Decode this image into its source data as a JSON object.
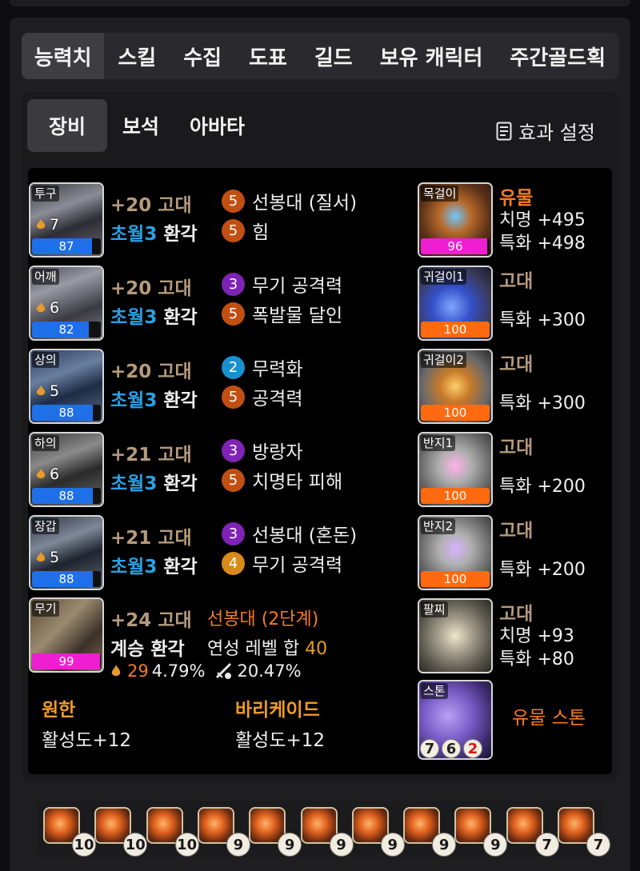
{
  "main_tabs": [
    "능력치",
    "스킬",
    "수집",
    "도표",
    "길드",
    "보유 캐릭터",
    "주간골드획"
  ],
  "sub_tabs": [
    "장비",
    "보석",
    "아바타"
  ],
  "effect_button": "효과 설정",
  "equipment": [
    {
      "slot": "투구",
      "level": "7",
      "quality": 87,
      "quality_color": "#1f6fe8",
      "upgrade": "+20 고대",
      "transcend": "초월3",
      "elixir": "환각",
      "engravings": [
        {
          "level": "5",
          "color": "orange",
          "name": "선봉대 (질서)"
        },
        {
          "level": "5",
          "color": "orange",
          "name": "힘"
        }
      ]
    },
    {
      "slot": "어깨",
      "level": "6",
      "quality": 82,
      "quality_color": "#1f6fe8",
      "upgrade": "+20 고대",
      "transcend": "초월3",
      "elixir": "환각",
      "engravings": [
        {
          "level": "3",
          "color": "purple",
          "name": "무기 공격력"
        },
        {
          "level": "5",
          "color": "orange",
          "name": "폭발물 달인"
        }
      ]
    },
    {
      "slot": "상의",
      "level": "5",
      "quality": 88,
      "quality_color": "#1f6fe8",
      "upgrade": "+20 고대",
      "transcend": "초월3",
      "elixir": "환각",
      "engravings": [
        {
          "level": "2",
          "color": "blue",
          "name": "무력화"
        },
        {
          "level": "5",
          "color": "orange",
          "name": "공격력"
        }
      ]
    },
    {
      "slot": "하의",
      "level": "6",
      "quality": 88,
      "quality_color": "#1f6fe8",
      "upgrade": "+21 고대",
      "transcend": "초월3",
      "elixir": "환각",
      "engravings": [
        {
          "level": "3",
          "color": "purple",
          "name": "방랑자"
        },
        {
          "level": "5",
          "color": "orange",
          "name": "치명타 피해"
        }
      ]
    },
    {
      "slot": "장갑",
      "level": "5",
      "quality": 88,
      "quality_color": "#1f6fe8",
      "upgrade": "+21 고대",
      "transcend": "초월3",
      "elixir": "환각",
      "engravings": [
        {
          "level": "3",
          "color": "purple",
          "name": "선봉대 (혼돈)"
        },
        {
          "level": "4",
          "color": "amber",
          "name": "무기 공격력"
        }
      ]
    }
  ],
  "weapon": {
    "slot": "무기",
    "quality": 99,
    "quality_color": "#f01ed2",
    "upgrade": "+24 고대",
    "set": "선봉대 (2단계)",
    "succession": "계승",
    "elixir": "환각",
    "refine_label": "연성 레벨 합",
    "refine_value": "40",
    "stat_a_num": "29",
    "stat_a_pct": "4.79%",
    "stat_b_pct": "20.47%"
  },
  "set_effects": [
    {
      "name": "원한",
      "value": "활성도+12"
    },
    {
      "name": "바리케이드",
      "value": "활성도+12"
    }
  ],
  "accessories": [
    {
      "slot": "목걸이",
      "quality": 96,
      "quality_color": "#f01ed2",
      "grade": "유물",
      "grade_color": "#f37b22",
      "stats": [
        "치명 +495",
        "특화 +498"
      ]
    },
    {
      "slot": "귀걸이1",
      "quality": 100,
      "quality_color": "#ff6a10",
      "grade": "고대",
      "grade_color": "#b59a7c",
      "stats": [
        "특화 +300"
      ]
    },
    {
      "slot": "귀걸이2",
      "quality": 100,
      "quality_color": "#ff6a10",
      "grade": "고대",
      "grade_color": "#b59a7c",
      "stats": [
        "특화 +300"
      ]
    },
    {
      "slot": "반지1",
      "quality": 100,
      "quality_color": "#ff6a10",
      "grade": "고대",
      "grade_color": "#b59a7c",
      "stats": [
        "특화 +200"
      ]
    },
    {
      "slot": "반지2",
      "quality": 100,
      "quality_color": "#ff6a10",
      "grade": "고대",
      "grade_color": "#b59a7c",
      "stats": [
        "특화 +200"
      ]
    },
    {
      "slot": "팔찌",
      "quality": null,
      "grade": "고대",
      "grade_color": "#b59a7c",
      "stats": [
        "치명 +93",
        "특화 +80"
      ]
    }
  ],
  "stone": {
    "slot": "스톤",
    "grade": "유물 스톤",
    "values": [
      "7",
      "6",
      "2"
    ]
  },
  "gems": [
    "10",
    "10",
    "10",
    "9",
    "9",
    "9",
    "9",
    "9",
    "9",
    "7",
    "7"
  ]
}
